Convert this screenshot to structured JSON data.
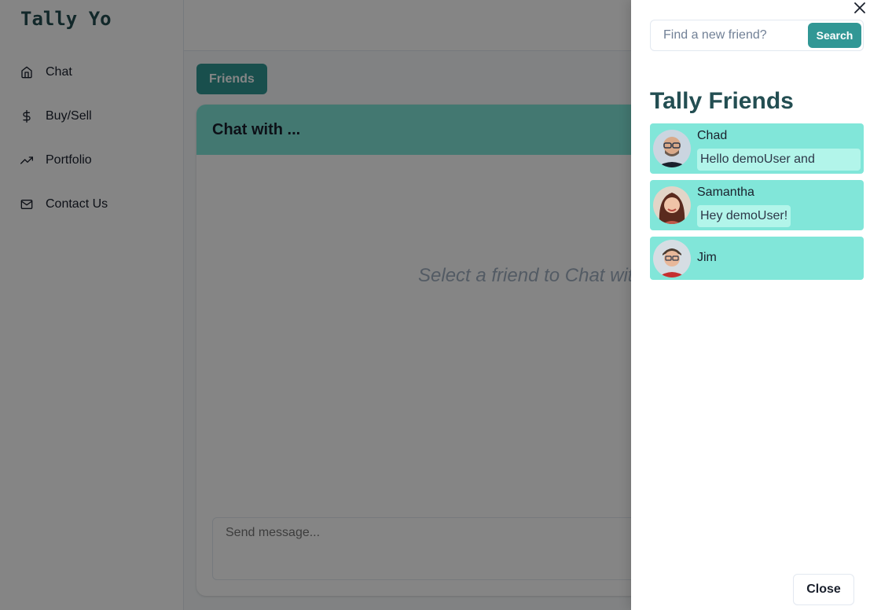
{
  "app": {
    "logo": "Tally Yo"
  },
  "sidebar": {
    "items": [
      {
        "label": "Chat",
        "icon": "home-icon"
      },
      {
        "label": "Buy/Sell",
        "icon": "dollar-icon"
      },
      {
        "label": "Portfolio",
        "icon": "trending-up-icon"
      },
      {
        "label": "Contact Us",
        "icon": "mail-icon"
      }
    ]
  },
  "main": {
    "friends_button": "Friends",
    "chat_title": "Chat with ...",
    "empty_text": "Select a friend to Chat with",
    "message_placeholder": "Send message..."
  },
  "drawer": {
    "search_placeholder": "Find a new friend?",
    "search_button": "Search",
    "title": "Tally Friends",
    "friends": [
      {
        "name": "Chad",
        "preview": "Hello demoUser and"
      },
      {
        "name": "Samantha",
        "preview": "Hey demoUser!"
      },
      {
        "name": "Jim",
        "preview": ""
      }
    ],
    "close_button": "Close"
  },
  "colors": {
    "brand": "#319795",
    "friend_bg": "#81e6d9",
    "preview_bg": "#b2f5ea",
    "logo": "#234e52"
  }
}
